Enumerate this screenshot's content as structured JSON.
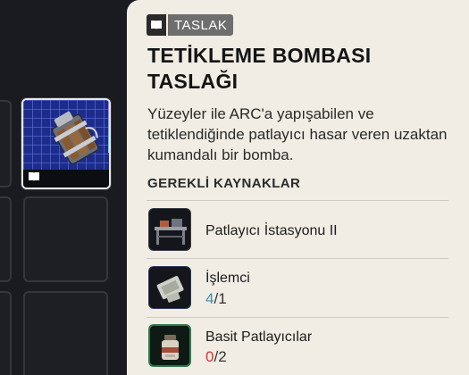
{
  "inventory": {
    "selected_item": {
      "icon": "trigger-bomb-item",
      "type_icon": "book-icon"
    }
  },
  "tooltip": {
    "badge": {
      "icon": "book-icon",
      "label": "TASLAK"
    },
    "title": "TETİKLEME BOMBASI TASLAĞI",
    "description": "Yüzeyler ile ARC'a yapışabilen ve tetiklendiğinde patlayıcı hasar veren uzaktan kumandalı bir bomba.",
    "requirements_header": "GEREKLİ KAYNAKLAR",
    "requirements": [
      {
        "name": "Patlayıcı İstasyonu II",
        "icon": "workbench-icon"
      },
      {
        "name": "İşlemci",
        "have": "4",
        "sep_need": "/1",
        "icon": "processor-icon"
      },
      {
        "name": "Basit Patlayıcılar",
        "have": "0",
        "sep_need": "/2",
        "icon": "explosives-icon"
      }
    ]
  },
  "colors": {
    "panel_bg": "#f1ede4",
    "have_enough": "#3f8fb4",
    "have_insufficient": "#d8342c",
    "blueprint_bg": "#1d2c8a"
  }
}
